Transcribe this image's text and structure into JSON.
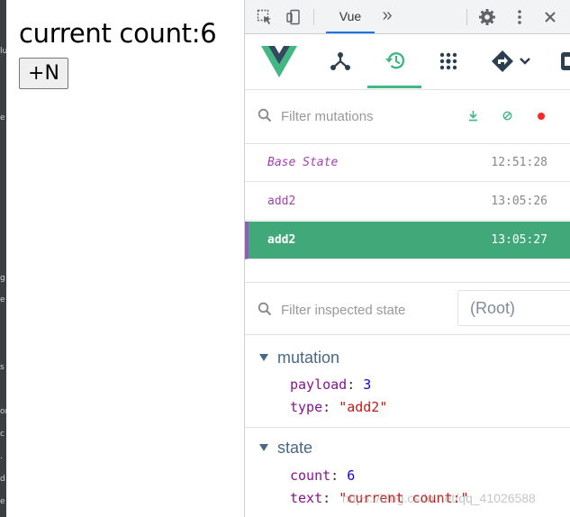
{
  "app": {
    "count_label": "current count:6",
    "button_label": "+N"
  },
  "devtools": {
    "active_tab": "Vue",
    "more_tabs_glyph": "»",
    "mutations_filter": {
      "placeholder": "Filter mutations"
    },
    "mutations": [
      {
        "name": "Base State",
        "time": "12:51:28"
      },
      {
        "name": "add2",
        "time": "13:05:26"
      },
      {
        "name": "add2",
        "time": "13:05:27"
      }
    ],
    "state_filter": {
      "placeholder": "Filter inspected state"
    },
    "root_select": "(Root)",
    "sections": {
      "mutation": {
        "title": "mutation",
        "payload_key": "payload",
        "payload_value": "3",
        "type_key": "type",
        "type_value": "\"add2\""
      },
      "state": {
        "title": "state",
        "count_key": "count",
        "count_value": "6",
        "text_key": "text",
        "text_value": "\"current count:\""
      }
    },
    "colors": {
      "vue_green": "#41b883",
      "selected_row": "#41a87a",
      "mutation_name": "#a33fb1",
      "record_red": "#ff2727"
    }
  },
  "watermark": "https://blog.csdn.net/qq_41026588",
  "left_strip_marks": [
    "lu",
    "e",
    "g",
    "e",
    "s",
    "or",
    "c",
    ".",
    "d",
    "e"
  ]
}
